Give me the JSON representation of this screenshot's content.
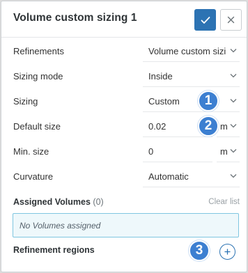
{
  "header": {
    "title": "Volume custom sizing 1"
  },
  "fields": {
    "refinements": {
      "label": "Refinements",
      "value": "Volume custom sizing"
    },
    "sizing_mode": {
      "label": "Sizing mode",
      "value": "Inside"
    },
    "sizing": {
      "label": "Sizing",
      "value": "Custom"
    },
    "default_size": {
      "label": "Default size",
      "value": "0.02",
      "unit": "m"
    },
    "min_size": {
      "label": "Min. size",
      "value": "0",
      "unit": "m"
    },
    "curvature": {
      "label": "Curvature",
      "value": "Automatic"
    }
  },
  "assigned_volumes": {
    "title": "Assigned Volumes",
    "count": "(0)",
    "clear_label": "Clear list",
    "empty_text": "No Volumes assigned"
  },
  "refinement_regions": {
    "title": "Refinement regions"
  },
  "badges": [
    "1",
    "2",
    "3"
  ],
  "colors": {
    "accent": "#2c73b3",
    "badge": "#3c7fd1",
    "empty_box_bg": "#eef8fb",
    "empty_box_border": "#7fc6e0"
  },
  "icons": {
    "confirm": "checkmark-icon",
    "close": "close-icon",
    "dropdown": "chevron-down-icon",
    "add": "plus-icon"
  }
}
